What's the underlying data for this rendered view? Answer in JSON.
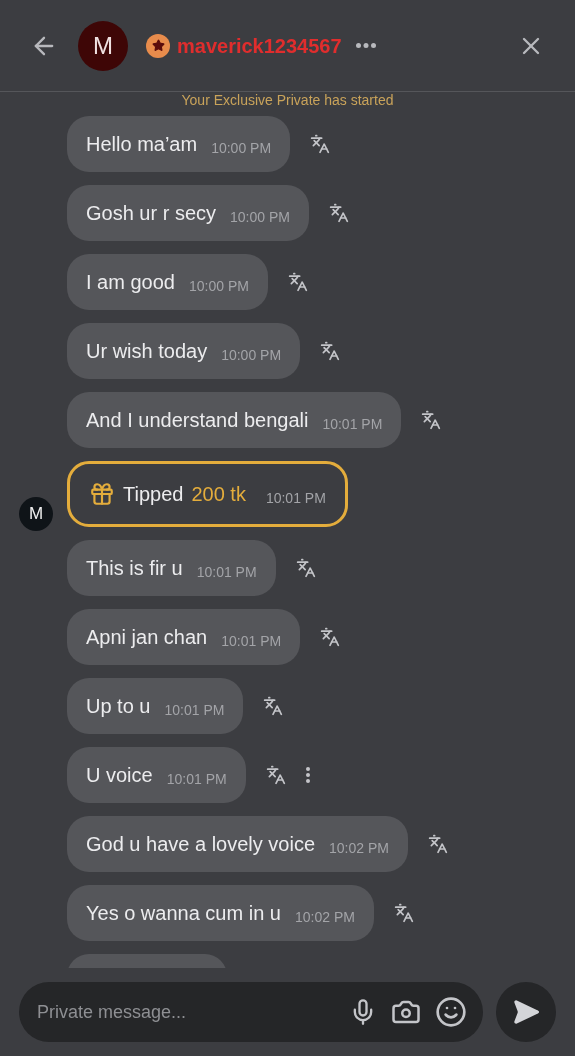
{
  "header": {
    "avatar_letter": "M",
    "username": "maverick1234567",
    "notice": "Your Exclusive Private has started"
  },
  "messages": [
    {
      "kind": "text",
      "text": "Hello ma’am",
      "time": "10:00 PM",
      "menu": false
    },
    {
      "kind": "text",
      "text": "Gosh ur r secy",
      "time": "10:00 PM",
      "menu": false
    },
    {
      "kind": "text",
      "text": "I am good",
      "time": "10:00 PM",
      "menu": false
    },
    {
      "kind": "text",
      "text": "Ur wish today",
      "time": "10:00 PM",
      "menu": false
    },
    {
      "kind": "text",
      "text": "And I understand bengali",
      "time": "10:01 PM",
      "menu": false
    },
    {
      "kind": "tip",
      "avatar_letter": "M",
      "label": "Tipped",
      "amount": "200 tk",
      "time": "10:01 PM"
    },
    {
      "kind": "text",
      "text": "This is fir u",
      "time": "10:01 PM",
      "menu": false
    },
    {
      "kind": "text",
      "text": "Apni jan chan",
      "time": "10:01 PM",
      "menu": false
    },
    {
      "kind": "text",
      "text": "Up to u",
      "time": "10:01 PM",
      "menu": false
    },
    {
      "kind": "text",
      "text": "U voice",
      "time": "10:01 PM",
      "menu": true
    },
    {
      "kind": "text",
      "text": "God u have a lovely voice",
      "time": "10:02 PM",
      "menu": false
    },
    {
      "kind": "text",
      "text": "Yes o wanna cum in u",
      "time": "10:02 PM",
      "menu": false
    }
  ],
  "composer": {
    "placeholder": "Private message..."
  }
}
